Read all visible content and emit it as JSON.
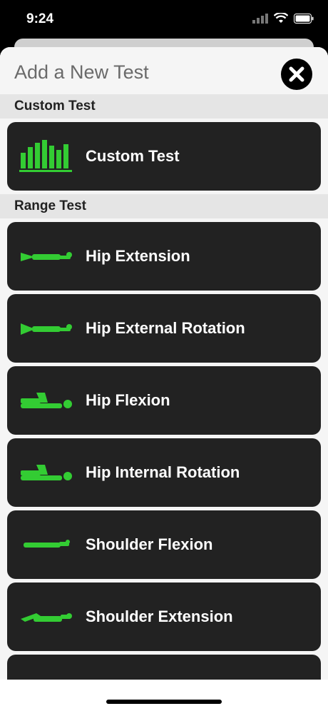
{
  "status": {
    "time": "9:24"
  },
  "sheet": {
    "title": "Add a New Test"
  },
  "sections": [
    {
      "header": "Custom Test",
      "items": [
        {
          "label": "Custom Test",
          "icon": "bar-chart-icon"
        }
      ]
    },
    {
      "header": "Range Test",
      "items": [
        {
          "label": "Hip Extension",
          "icon": "hip-extension-icon"
        },
        {
          "label": "Hip External Rotation",
          "icon": "hip-external-rotation-icon"
        },
        {
          "label": "Hip Flexion",
          "icon": "hip-flexion-icon"
        },
        {
          "label": "Hip Internal Rotation",
          "icon": "hip-internal-rotation-icon"
        },
        {
          "label": "Shoulder Flexion",
          "icon": "shoulder-flexion-icon"
        },
        {
          "label": "Shoulder Extension",
          "icon": "shoulder-extension-icon"
        }
      ]
    }
  ],
  "colors": {
    "accent": "#33cc33",
    "card": "#222222",
    "sheet": "#f5f5f5",
    "section": "#e5e5e5"
  }
}
